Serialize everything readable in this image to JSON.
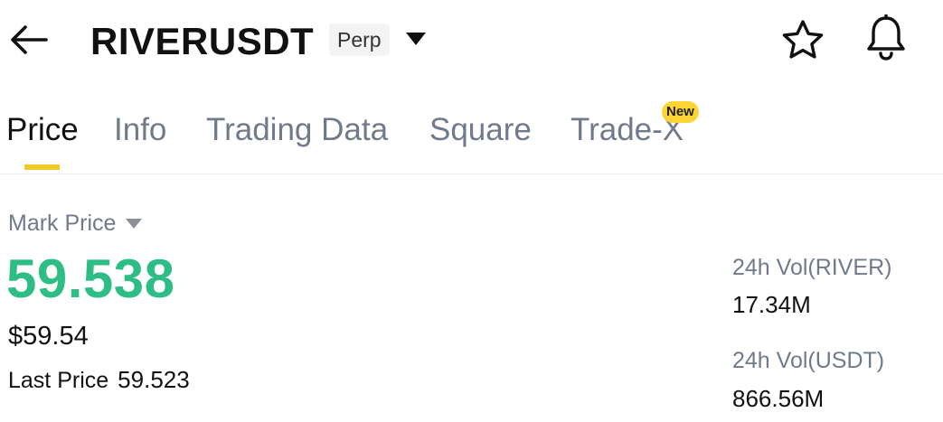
{
  "header": {
    "back_icon": "arrow-left-icon",
    "symbol": "RIVERUSDT",
    "contract_type": "Perp",
    "dropdown_icon": "caret-down-icon",
    "favorite_icon": "star-icon",
    "alert_icon": "bell-icon"
  },
  "tabs": [
    {
      "label": "Price",
      "active": true
    },
    {
      "label": "Info",
      "active": false
    },
    {
      "label": "Trading Data",
      "active": false
    },
    {
      "label": "Square",
      "active": false
    },
    {
      "label": "Trade-X",
      "active": false,
      "badge": "New"
    }
  ],
  "price": {
    "mark_price_label": "Mark Price",
    "mark_price": "59.538",
    "usd_price": "$59.54",
    "last_price_label": "Last Price",
    "last_price": "59.523"
  },
  "stats": {
    "vol_base_label": "24h Vol(RIVER)",
    "vol_base_value": "17.34M",
    "vol_quote_label": "24h Vol(USDT)",
    "vol_quote_value": "866.56M"
  },
  "colors": {
    "positive": "#2ebd85",
    "accent": "#f0c929",
    "badge": "#fcd535",
    "muted_text": "#707a8a"
  }
}
